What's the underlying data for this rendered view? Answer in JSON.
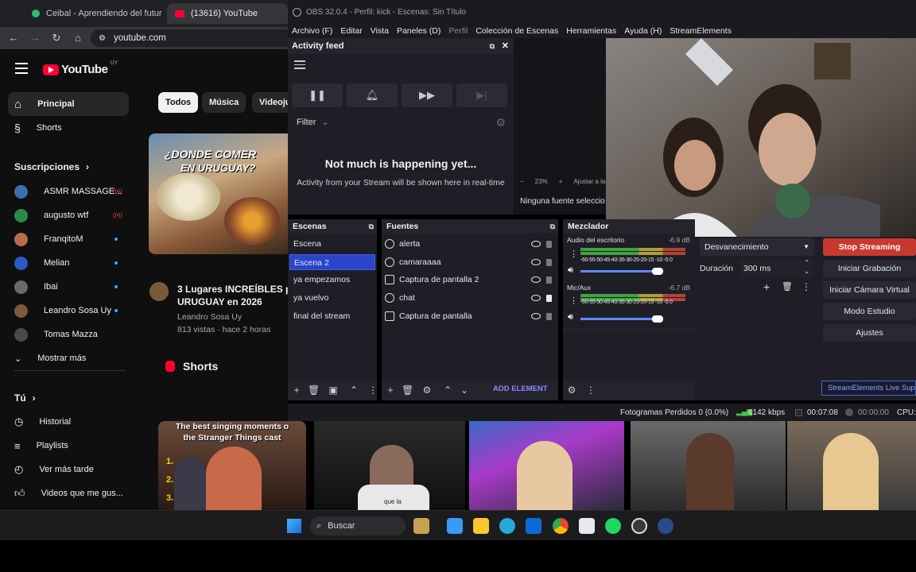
{
  "chrome": {
    "tab1_title": "Ceibal - Aprendiendo del futur",
    "tab2_title": "(13616) YouTube",
    "url": "youtube.com"
  },
  "youtube": {
    "logo_text": "YouTube",
    "region": "UY",
    "nav": [
      {
        "label": "Principal",
        "icon": "home-icon"
      },
      {
        "label": "Shorts",
        "icon": "shorts-icon"
      }
    ],
    "subs_header": "Suscripciones",
    "subscriptions": [
      {
        "name": "ASMR MASSAGE...",
        "status": "live",
        "color": "#3a6fb0"
      },
      {
        "name": "augusto wtf",
        "status": "live",
        "color": "#2a8a4a"
      },
      {
        "name": "FranqitoM",
        "status": "new",
        "color": "#b86a4a"
      },
      {
        "name": "Melian",
        "status": "new",
        "color": "#2a5ac8"
      },
      {
        "name": "Ibai",
        "status": "new",
        "color": "#6a6a6a"
      },
      {
        "name": "Leandro Sosa Uy",
        "status": "new",
        "color": "#7a5a3a"
      },
      {
        "name": "Tomas Mazza",
        "status": "",
        "color": "#4a4a4a"
      }
    ],
    "show_more": "Mostrar más",
    "you_header": "Tú",
    "you_items": [
      {
        "label": "Historial",
        "icon": "history-icon"
      },
      {
        "label": "Playlists",
        "icon": "playlists-icon"
      },
      {
        "label": "Ver más tarde",
        "icon": "watch-later-icon"
      },
      {
        "label": "Videos que me gus...",
        "icon": "thumbs-up-icon"
      }
    ],
    "chips": [
      "Todos",
      "Música",
      "Videoju"
    ],
    "video": {
      "thumb_text_1": "¿DONDE COMER",
      "thumb_text_2": "EN URUGUAY?",
      "title_1": "3 Lugares INCREÍBLES pa",
      "title_2": "URUGUAY en 2026",
      "channel": "Leandro Sosa Uy",
      "meta": "813 vistas · hace 2 horas"
    },
    "shorts_header": "Shorts",
    "short1_caption_1": "The best singing moments o",
    "short1_caption_2": "the Stranger Things cast",
    "short1_list": [
      "1.",
      "2.",
      "3."
    ],
    "short2_caption": "que la"
  },
  "obs": {
    "title": "OBS 32.0.4 - Perfil: kick - Escenas: Sin Título",
    "menu": [
      "Archivo (F)",
      "Editar",
      "Vista",
      "Paneles (D)",
      "Perfil",
      "Colección de Escenas",
      "Herramientas",
      "Ayuda (H)",
      "StreamElements"
    ],
    "activity": {
      "title": "Activity feed",
      "filter": "Filter",
      "empty_title": "Not much is happening yet...",
      "empty_sub": "Activity from your Stream will be shown here in real-time"
    },
    "preview": {
      "zoom": "23%",
      "fit": "Ajustar a la",
      "no_source": "Ninguna fuente seleccio"
    },
    "scenes": {
      "title": "Escenas",
      "items": [
        "Escena",
        "Escena 2",
        "ya empezamos",
        "ya vuelvo",
        "final del stream"
      ],
      "selected": 1
    },
    "sources": {
      "title": "Fuentes",
      "items": [
        {
          "name": "alerta",
          "icon": "browser-source-icon",
          "locked": false
        },
        {
          "name": "camaraaaa",
          "icon": "camera-source-icon",
          "locked": false
        },
        {
          "name": "Captura de pantalla 2",
          "icon": "screen-capture-icon",
          "locked": false
        },
        {
          "name": "chat",
          "icon": "browser-source-icon",
          "locked": true
        },
        {
          "name": "Captura de pantalla",
          "icon": "screen-capture-icon",
          "locked": false
        }
      ],
      "add_element": "ADD ELEMENT"
    },
    "mixer": {
      "title": "Mezclador",
      "channels": [
        {
          "name": "Audio del escritorio",
          "db": "-6.9 dB",
          "volume": 0.9
        },
        {
          "name": "Mic/Aux",
          "db": "-6.7 dB",
          "volume": 0.9
        }
      ],
      "scale": "-60-55-50-45-40-35-30-25-20-15 -10 -5 0"
    },
    "transitions": {
      "type": "Desvanecimiento",
      "duration_label": "Duración",
      "duration_value": "300 ms"
    },
    "controls": [
      "Stop Streaming",
      "Iniciar Grabación",
      "Iniciar Cámara Virtual",
      "Modo Estudio",
      "Ajustes"
    ],
    "se_live": "StreamElements Live Sup",
    "status": {
      "dropped": "Fotogramas Perdidos 0 (0.0%)",
      "bitrate": "6142 kbps",
      "stream_time": "00:07:08",
      "rec_time": "00:00:00",
      "cpu": "CPU:"
    }
  },
  "taskbar": {
    "search": "Buscar"
  }
}
